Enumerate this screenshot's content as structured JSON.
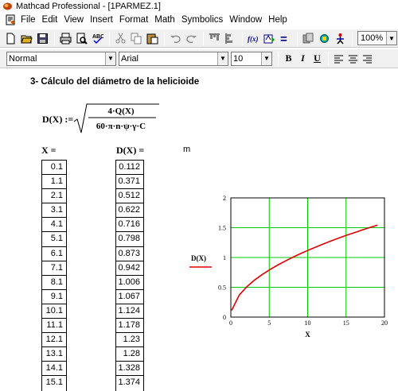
{
  "window": {
    "title": "Mathcad Professional - [1PARMEZ.1]"
  },
  "menu": {
    "items": [
      "File",
      "Edit",
      "View",
      "Insert",
      "Format",
      "Math",
      "Symbolics",
      "Window",
      "Help"
    ]
  },
  "toolbar": {
    "icons": [
      "new-icon",
      "open-icon",
      "save-icon",
      "print-icon",
      "print-preview-icon",
      "spell-check-icon",
      "cut-icon",
      "copy-icon",
      "paste-icon",
      "undo-icon",
      "redo-icon",
      "align-icon",
      "align-down-icon",
      "insert-function-icon",
      "insert-unit-icon",
      "calculate-icon",
      "resource-icon",
      "component-icon",
      "help-icon"
    ],
    "function_label": "f(x)",
    "equals_label": "=",
    "zoom": "100%"
  },
  "formatbar": {
    "style": "Normal",
    "font": "Arial",
    "size": "10",
    "bold": "B",
    "italic": "I",
    "underline": "U"
  },
  "worksheet": {
    "heading": "3- Cálculo del diámetro de la helicioide",
    "formula": {
      "lhs": "D(X) :=",
      "numerator": "4·Q(X)",
      "denominator": "60·π·n·ψ·γ·C"
    },
    "x_header": "X =",
    "d_header": "D(X) =",
    "unit": "m",
    "x_values": [
      "0.1",
      "1.1",
      "2.1",
      "3.1",
      "4.1",
      "5.1",
      "6.1",
      "7.1",
      "8.1",
      "9.1",
      "10.1",
      "11.1",
      "12.1",
      "13.1",
      "14.1",
      "15.1"
    ],
    "d_values": [
      "0.112",
      "0.371",
      "0.512",
      "0.622",
      "0.716",
      "0.798",
      "0.873",
      "0.942",
      "1.006",
      "1.067",
      "1.124",
      "1.178",
      "1.23",
      "1.28",
      "1.328",
      "1.374"
    ]
  },
  "chart_data": {
    "type": "line",
    "title": "",
    "xlabel": "X",
    "ylabel": "D(X)",
    "xlim": [
      0,
      20
    ],
    "ylim": [
      0,
      2
    ],
    "xticks": [
      "0",
      "5",
      "10",
      "15",
      "20"
    ],
    "yticks": [
      "0",
      "0.5",
      "1",
      "1.5",
      "2"
    ],
    "grid": true,
    "grid_color": "#00c800",
    "series": [
      {
        "color": "#e00000",
        "x": [
          0.1,
          1.1,
          2.1,
          3.1,
          4.1,
          5.1,
          6.1,
          7.1,
          8.1,
          9.1,
          10.1,
          11.1,
          12.1,
          13.1,
          14.1,
          15.1,
          16.1,
          17.1,
          18.1,
          19.1
        ],
        "y": [
          0.112,
          0.371,
          0.512,
          0.622,
          0.716,
          0.798,
          0.873,
          0.942,
          1.006,
          1.067,
          1.124,
          1.178,
          1.23,
          1.28,
          1.328,
          1.374,
          1.418,
          1.461,
          1.503,
          1.544
        ]
      }
    ]
  }
}
